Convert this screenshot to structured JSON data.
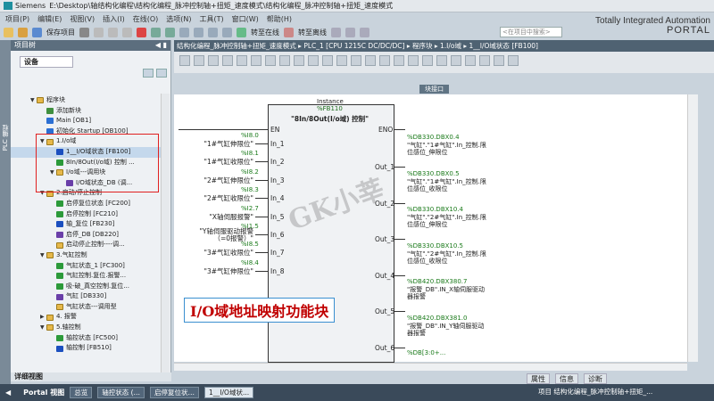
{
  "window": {
    "app": "Siemens",
    "path": "E:\\Desktop\\轴结构化编程\\结构化编程_脉冲控制轴+扭矩_速度模式\\结构化编程_脉冲控制轴+扭矩_速度模式",
    "brand_line1": "Totally Integrated Automation",
    "brand_line2": "PORTAL"
  },
  "menu": [
    "项目(P)",
    "编辑(E)",
    "视图(V)",
    "插入(I)",
    "在线(O)",
    "选项(N)",
    "工具(T)",
    "窗口(W)",
    "帮助(H)"
  ],
  "toolbar": {
    "save_label": "保存项目",
    "go_online": "转至在线",
    "go_offline": "转至离线",
    "search_placeholder": "<在项目中搜索>"
  },
  "left": {
    "strip_label": "PLC 编程",
    "panel_title": "项目树",
    "devices_tab": "设备",
    "detail_view": "详细视图",
    "tree": [
      {
        "level": 0,
        "icon": "grp",
        "label": "程序块",
        "twisty": "▼"
      },
      {
        "level": 1,
        "icon": "add",
        "label": "添加新块"
      },
      {
        "level": 1,
        "icon": "ob",
        "label": "Main [OB1]"
      },
      {
        "level": 1,
        "icon": "ob",
        "label": "初始化 Startup [OB100]"
      },
      {
        "level": 1,
        "icon": "grp",
        "label": "1.I/o域",
        "twisty": "▼"
      },
      {
        "level": 2,
        "icon": "fb",
        "label": "1__I/O域状态 [FB100]"
      },
      {
        "level": 2,
        "icon": "fc",
        "label": "8In/8Out(I/o域) 控制 ..."
      },
      {
        "level": 2,
        "icon": "grp",
        "label": "I/o域---调用块",
        "twisty": "▼"
      },
      {
        "level": 3,
        "icon": "db",
        "label": "I/O域状态_DB (调..."
      },
      {
        "level": 1,
        "icon": "grp",
        "label": "2.启动/停止控制",
        "twisty": "▼"
      },
      {
        "level": 2,
        "icon": "fc",
        "label": "启停复位状态 [FC200]"
      },
      {
        "level": 2,
        "icon": "fc",
        "label": "启停控制 [FC210]"
      },
      {
        "level": 2,
        "icon": "fb",
        "label": "轴_复位 [FB230]"
      },
      {
        "level": 2,
        "icon": "db",
        "label": "启停_DB [DB220]"
      },
      {
        "level": 2,
        "icon": "grp",
        "label": "启动停止控制----调..."
      },
      {
        "level": 1,
        "icon": "grp",
        "label": "3.气缸控制",
        "twisty": "▼"
      },
      {
        "level": 2,
        "icon": "fc",
        "label": "气缸状态_1 [FC300]"
      },
      {
        "level": 2,
        "icon": "fc",
        "label": "气缸控制.复位.报警..."
      },
      {
        "level": 2,
        "icon": "fc",
        "label": "吸-破_真空控制.复位..."
      },
      {
        "level": 2,
        "icon": "db",
        "label": "气缸 [DB330]"
      },
      {
        "level": 2,
        "icon": "grp",
        "label": "气缸状态---调用型"
      },
      {
        "level": 1,
        "icon": "grp",
        "label": "4. 报警",
        "twisty": "▶"
      },
      {
        "level": 1,
        "icon": "grp",
        "label": "5.轴控制",
        "twisty": "▼"
      },
      {
        "level": 2,
        "icon": "fc",
        "label": "轴控状态 [FC500]"
      },
      {
        "level": 2,
        "icon": "fb",
        "label": "轴控制 [FB510]"
      }
    ]
  },
  "editor": {
    "breadcrumb": "结构化编程_脉冲控制轴+扭矩_速度模式 ▸ PLC_1 [CPU 1215C DC/DC/DC] ▸ 程序块 ▸ 1.I/o域 ▸ 1__I/O域状态 [FB100]",
    "block_interface": "块接口",
    "instance_label": "Instance",
    "instance_db": "%FB110",
    "block_name": "\"8In/8Out(I/o域) 控制\"",
    "en": "EN",
    "eno": "ENO",
    "inputs": [
      {
        "pin": "In_1",
        "addr": "%I8.0",
        "tag": "\"1#气缸伸限位\""
      },
      {
        "pin": "In_2",
        "addr": "%I8.1",
        "tag": "\"1#气缸收限位\""
      },
      {
        "pin": "In_3",
        "addr": "%I8.2",
        "tag": "\"2#气缸伸限位\""
      },
      {
        "pin": "In_4",
        "addr": "%I8.3",
        "tag": "\"2#气缸收限位\""
      },
      {
        "pin": "In_5",
        "addr": "%I2.7",
        "tag": "\"X轴伺服报警\""
      },
      {
        "pin": "In_6",
        "addr": "%I1.5",
        "tag": "\"Y轴伺服驱动报警（=0报警）\""
      },
      {
        "pin": "In_7",
        "addr": "%I8.5",
        "tag": "\"3#气缸收限位\""
      },
      {
        "pin": "In_8",
        "addr": "%I8.4",
        "tag": "\"3#气缸伸限位\""
      }
    ],
    "outputs": [
      {
        "pin": "Out_1",
        "addr": "%DB330.DBX0.4",
        "text": "\"气缸\".\"1#气缸\".In_控制.限位感位_伸限位"
      },
      {
        "pin": "Out_2",
        "addr": "%DB330.DBX0.5",
        "text": "\"气缸\".\"1#气缸\".In_控制.限位感位_收限位"
      },
      {
        "pin": "Out_3",
        "addr": "%DB330.DBX10.4",
        "text": "\"气缸\".\"2#气缸\".In_控制.限位感位_伸限位"
      },
      {
        "pin": "Out_4",
        "addr": "%DB330.DBX10.5",
        "text": "\"气缸\".\"2#气缸\".In_控制.限位感位_收限位"
      },
      {
        "pin": "Out_5",
        "addr": "%DB420.DBX380.7",
        "text": "\"报警_DB\".IN_X轴伺服驱动器报警"
      },
      {
        "pin": "Out_6",
        "addr": "%DB420.DBX381.0",
        "text": "\"报警_DB\".IN_Y轴伺服驱动器报警"
      }
    ],
    "out_more": "%DB[3:0+...",
    "watermark": "GK小莘",
    "caption_io": "I/O",
    "caption_rest": "域地址映射功能块"
  },
  "bottom_tabs": [
    "属性",
    "信息",
    "诊断"
  ],
  "statusbar": {
    "portal_label": "Portal 视图",
    "tabs": [
      "总览",
      "轴控状态 (…",
      "启停复位状…",
      "1__I/O域状..."
    ],
    "message": "项目 结构化编程_脉冲控制轴+扭矩_..."
  }
}
